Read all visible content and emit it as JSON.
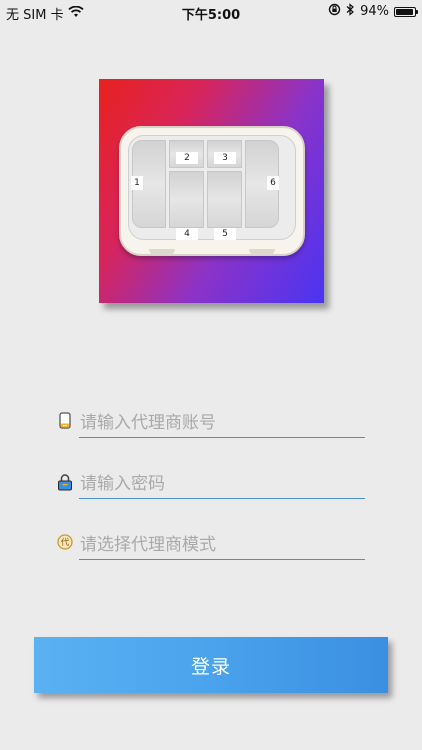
{
  "status_bar": {
    "carrier": "无 SIM 卡",
    "time": "下午5:00",
    "battery_percent": "94%",
    "battery_level": 0.94
  },
  "logo": {
    "slot_labels": [
      "1",
      "2",
      "3",
      "4",
      "5",
      "6"
    ],
    "gradient_colors": [
      "#e8221f",
      "#4a34f2"
    ]
  },
  "form": {
    "account_placeholder": "请输入代理商账号",
    "password_placeholder": "请输入密码",
    "mode_placeholder": "请选择代理商模式",
    "line_color": "#4c8fd1"
  },
  "login_button": {
    "label": "登录",
    "color": "#4aa3ec"
  }
}
